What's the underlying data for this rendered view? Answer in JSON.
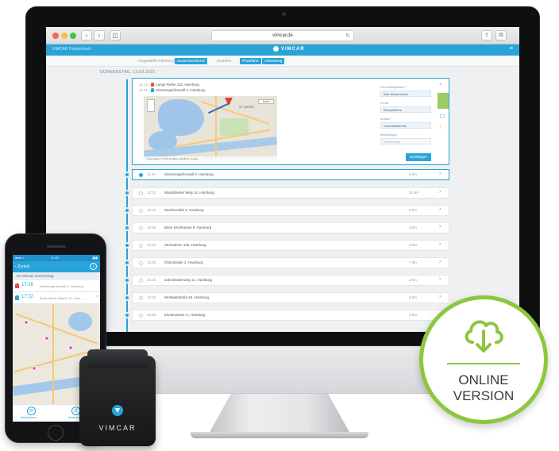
{
  "browser": {
    "url": "vimcar.de",
    "nav_back": "‹",
    "nav_forward": "›",
    "sidebar_toggle": "◫",
    "share": "⇪",
    "tabs": "⧉"
  },
  "app": {
    "account_label": "VIMCAR Fahrtenbuch",
    "brand": "VIMCAR",
    "accent_color": "#29a3d8",
    "menu_icon": "≡",
    "filters": [
      {
        "label": "Ausgewählte Fahrten (1)",
        "active": false
      },
      {
        "label": "Zusammenführen",
        "active": true
      },
      {
        "label": "Sortieren",
        "active": false
      },
      {
        "label": "Privatfahrt",
        "active": true
      },
      {
        "label": "Arbeitsweg",
        "active": true
      }
    ],
    "day_label": "DONNERSTAG, 13.03.2015"
  },
  "expanded_trip": {
    "start_time": "11:12",
    "start_address": "Lange Reihe 115, Hamburg",
    "end_time": "11:31",
    "end_address": "Glockengießerwall 2, Hamburg",
    "map_city_label": "ST. GEORG",
    "map_footer": "Kartendaten © 2015 GeoBasis-DE/BKG, Google",
    "map_type_label": "Karte",
    "form": {
      "purpose_label": "Geschäftspartner *",
      "purpose_value": "Max Mustermann",
      "company_label": "Firma",
      "company_value": "Beispielfirma",
      "reason_label": "Anlass *",
      "reason_value": "Geschäftstermin",
      "note_label": "Bemerkung",
      "note_placeholder": "Bemerkung…"
    },
    "save_label": "Bestätigen",
    "collapse_icon": "⌃",
    "comment_icon": "☐",
    "warning_icon": "!"
  },
  "trips": [
    {
      "time": "11:45",
      "address": "Glockengießerwall 2, Hamburg",
      "distance": "4 km",
      "selected": true
    },
    {
      "time": "12:20",
      "address": "Wandsbeker Weg 14, Hamburg",
      "distance": "11 km",
      "selected": false
    },
    {
      "time": "13:10",
      "address": "Sachsenfeld 4, Hamburg",
      "distance": "2 km",
      "selected": false
    },
    {
      "time": "13:40",
      "address": "Beim Strohhause 6, Hamburg",
      "distance": "1 km",
      "selected": false
    },
    {
      "time": "14:15",
      "address": "Steindamm 105, Hamburg",
      "distance": "4 km",
      "selected": false
    },
    {
      "time": "15:05",
      "address": "Ostrustraße 2, Hamburg",
      "distance": "7 km",
      "selected": false
    },
    {
      "time": "15:45",
      "address": "Jahnsbodenweg 14, Hamburg",
      "distance": "2 km",
      "selected": false
    },
    {
      "time": "16:20",
      "address": "Wohlwillstraße 55, Hamburg",
      "distance": "2 km",
      "selected": false
    },
    {
      "time": "16:55",
      "address": "Ekelenwasen 2, Hamburg",
      "distance": "2 km",
      "selected": false
    }
  ],
  "phone": {
    "carrier": "●●●○○",
    "time": "11:06",
    "battery": "▮▮▮",
    "back_label": "Zurück",
    "info_icon": "i",
    "date": "13 Februar, Donnerstag",
    "rows": [
      {
        "time": "17:26",
        "address": "Glockengießerwall 2, Hamburg",
        "pin_color": "#e24b4b"
      },
      {
        "time": "17:32",
        "address": "Ernst-Merck-Straße 12, Ham...",
        "pin_color": "#29a3d8"
      }
    ],
    "tab_left": "Aktualisieren",
    "tab_right": "Zusammenf.",
    "tab_left_icon": "⟳",
    "tab_right_icon": "⇵"
  },
  "dongle": {
    "brand": "VIMCAR"
  },
  "badge": {
    "line1": "ONLINE",
    "line2": "VERSION",
    "accent_color": "#8dc63f"
  }
}
